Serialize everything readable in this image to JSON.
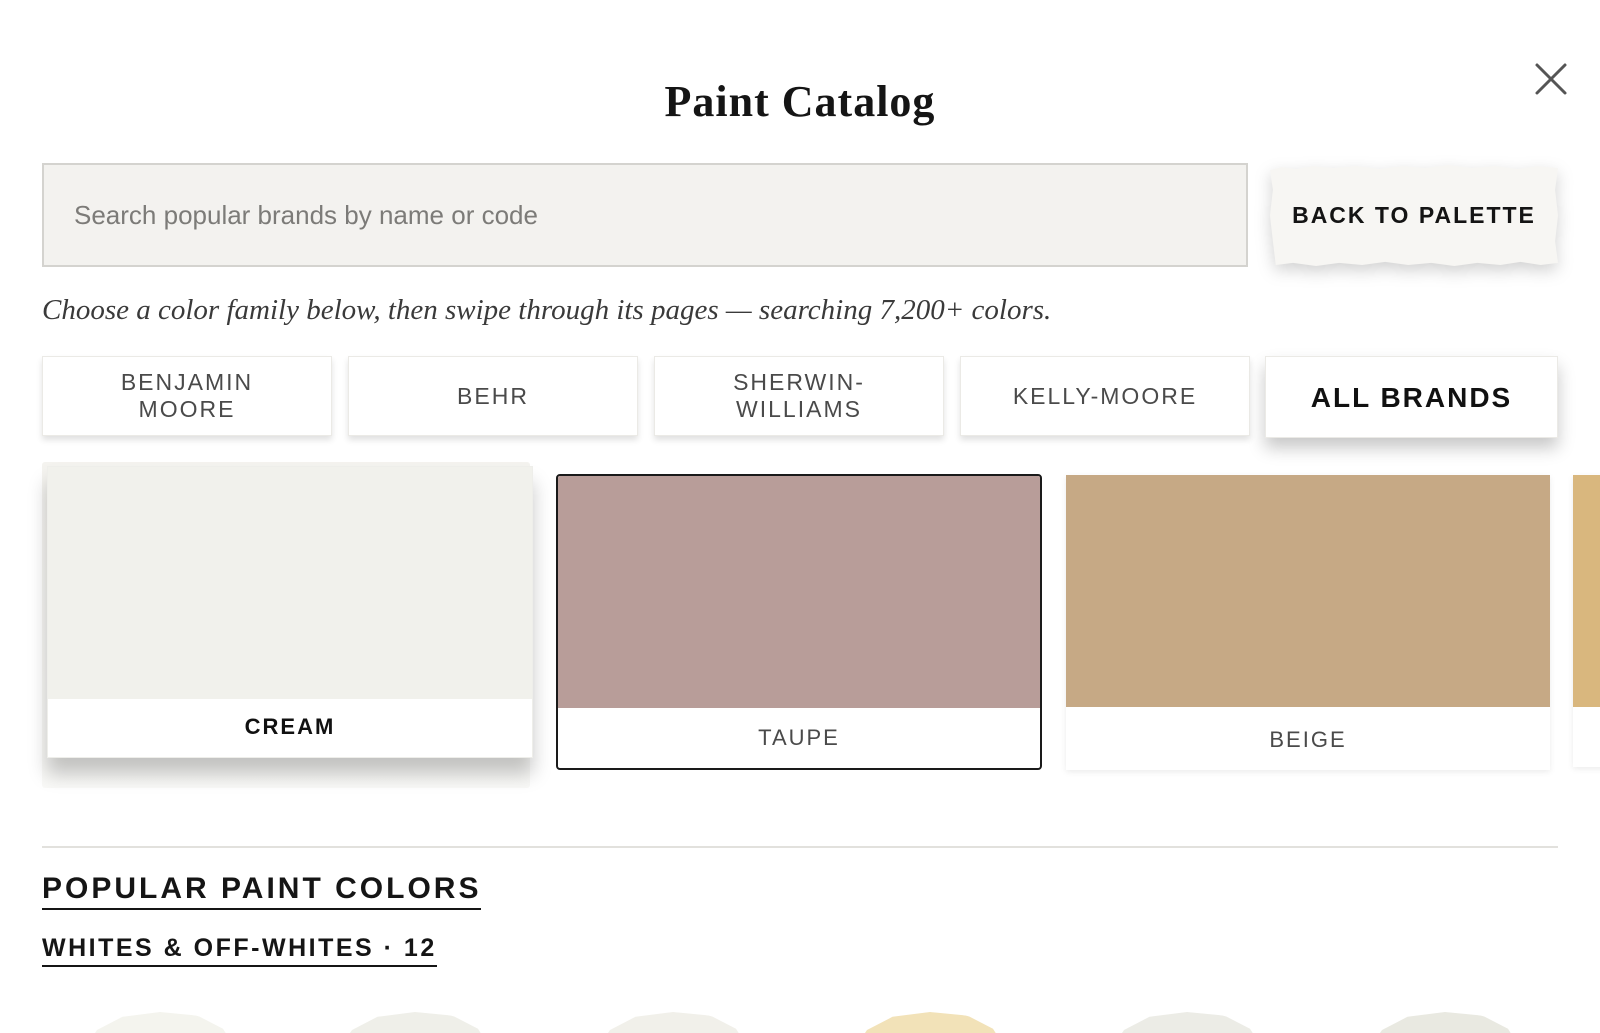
{
  "modal": {
    "title": "Paint Catalog",
    "close_icon": "close-icon"
  },
  "search": {
    "placeholder": "Search popular brands by name or code",
    "value": ""
  },
  "back_button": {
    "label": "BACK TO PALETTE"
  },
  "intro_text": "Choose a color family below, then swipe through its pages — searching 7,200+ colors.",
  "brands": [
    {
      "label": "BENJAMIN MOORE",
      "active": false
    },
    {
      "label": "BEHR",
      "active": false
    },
    {
      "label": "SHERWIN-WILLIAMS",
      "active": false
    },
    {
      "label": "KELLY-MOORE",
      "active": false
    },
    {
      "label": "ALL BRANDS",
      "active": true
    }
  ],
  "color_families": [
    {
      "label": "CREAM",
      "color": "#f1f1ec",
      "state": "lifted"
    },
    {
      "label": "TAUPE",
      "color": "#b89d99",
      "state": "selected"
    },
    {
      "label": "BEIGE",
      "color": "#c6a985",
      "state": "default"
    }
  ],
  "peek_family_color": "#d9b77e",
  "popular": {
    "heading": "POPULAR PAINT COLORS",
    "group_label": "WHITES & OFF-WHITES · 12",
    "chip_colors": [
      "#f4f4ee",
      "#efefe9",
      "#f1f0ea",
      "#f2e2b8",
      "#ececE6",
      "#e9e9e1"
    ]
  }
}
